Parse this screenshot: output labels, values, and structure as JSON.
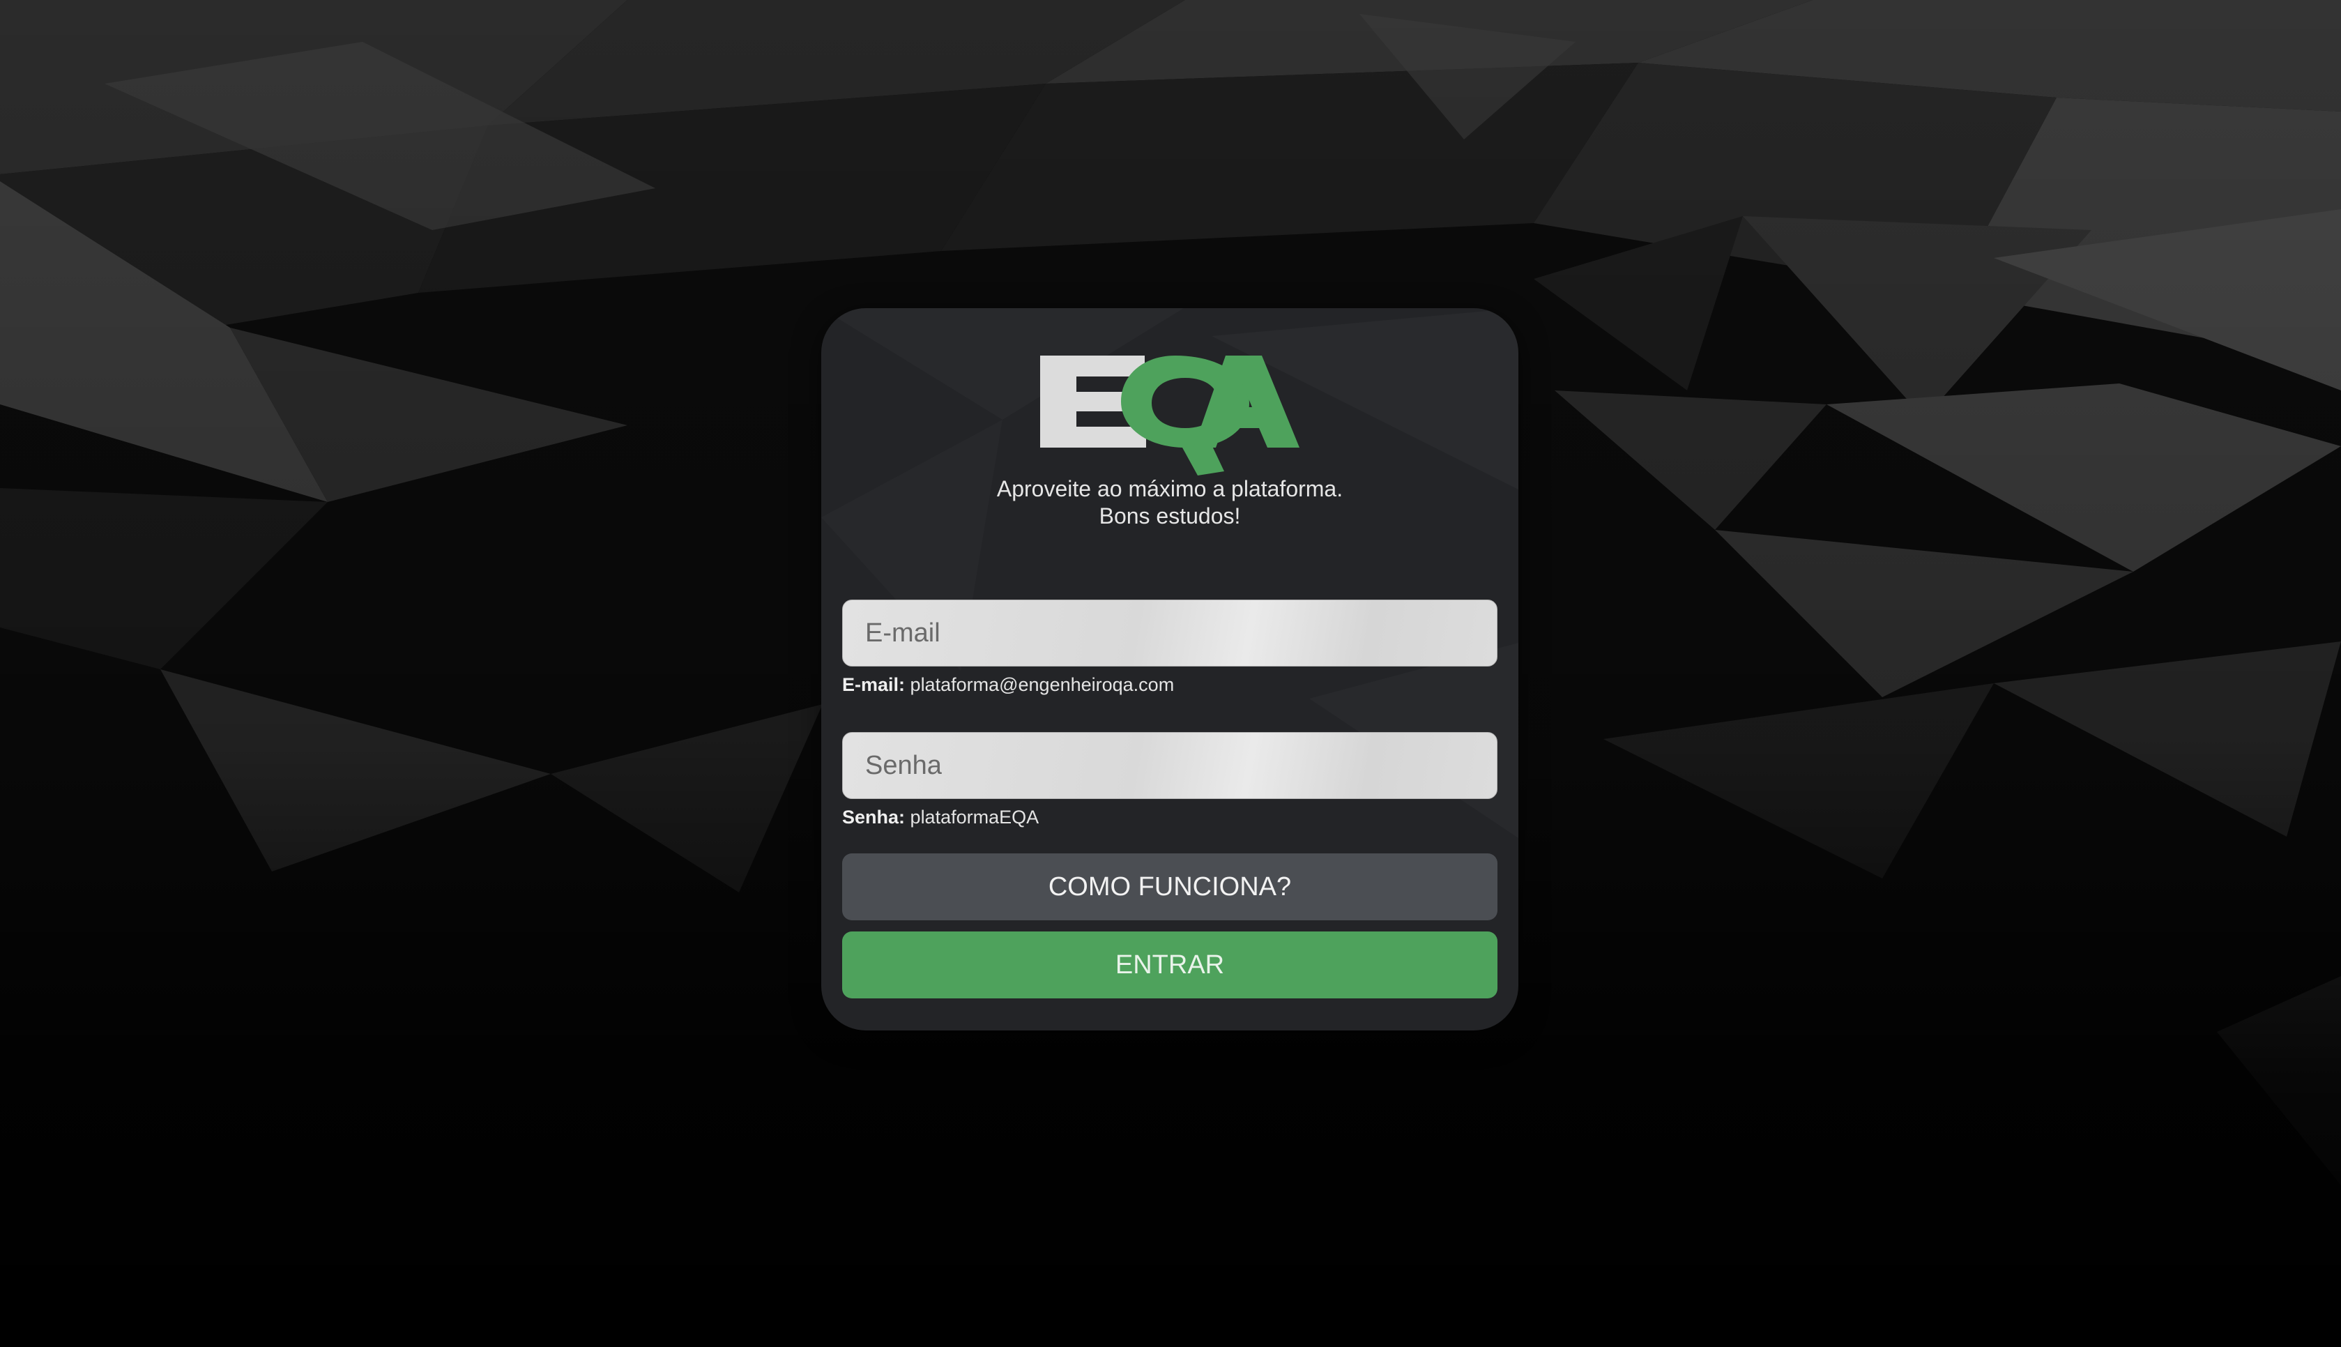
{
  "brand": {
    "logo_text": "EQA",
    "logo_colors": {
      "e": "#dcdcdc",
      "qa": "#4ea25c"
    }
  },
  "tagline": {
    "line1": "Aproveite ao máximo a plataforma.",
    "line2": "Bons estudos!"
  },
  "form": {
    "email": {
      "placeholder": "E-mail",
      "value": "",
      "hint_label": "E-mail:",
      "hint_value": "plataforma@engenheiroqa.com"
    },
    "password": {
      "placeholder": "Senha",
      "value": "",
      "hint_label": "Senha:",
      "hint_value": "plataformaEQA"
    }
  },
  "buttons": {
    "how_it_works": "COMO FUNCIONA?",
    "submit": "ENTRAR"
  },
  "colors": {
    "accent": "#4ea25c",
    "secondary_button": "#4b4e53",
    "card": "#26272a",
    "background": "#000000"
  }
}
